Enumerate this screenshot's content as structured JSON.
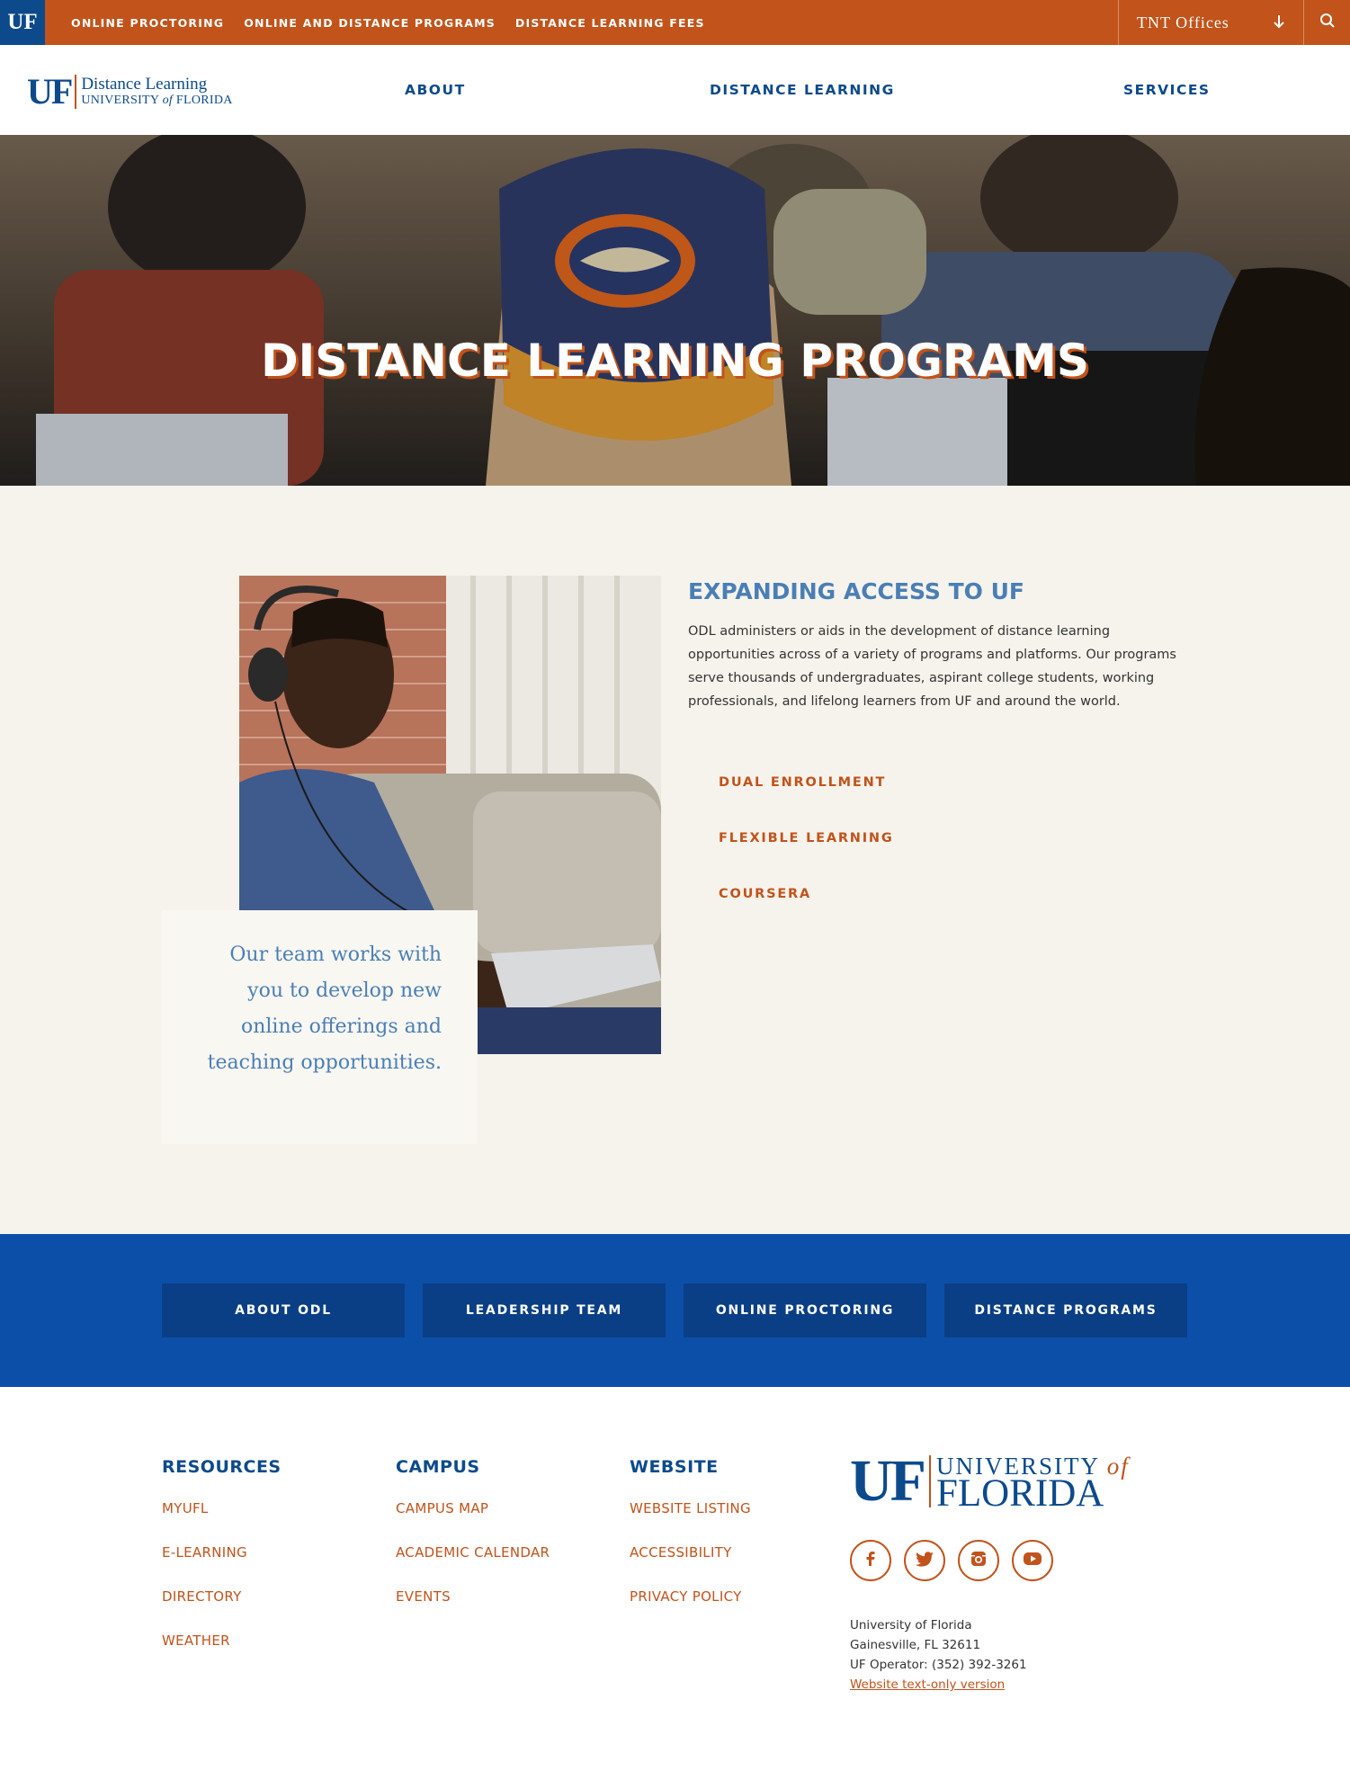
{
  "topbar": {
    "logo": "UF",
    "links": [
      "ONLINE PROCTORING",
      "ONLINE AND DISTANCE PROGRAMS",
      "DISTANCE LEARNING FEES"
    ],
    "dropdown_label": "TNT Offices"
  },
  "header": {
    "logo_uf": "UF",
    "logo_line1": "Distance Learning",
    "logo_line2_a": "UNIVERSITY ",
    "logo_line2_of": "of",
    "logo_line2_b": " FLORIDA",
    "nav": [
      "ABOUT",
      "DISTANCE LEARNING",
      "SERVICES"
    ]
  },
  "hero": {
    "title": "DISTANCE LEARNING PROGRAMS"
  },
  "content": {
    "quote": "Our team works with you to develop new online offerings and teaching opportunities.",
    "title": "EXPANDING ACCESS TO UF",
    "body": "ODL administers or aids in the development of distance learning opportunities across of a variety of programs and platforms. Our programs serve thousands of undergraduates, aspirant college students, working professionals, and lifelong learners from UF and around the world.",
    "links": [
      "DUAL ENROLLMENT",
      "FLEXIBLE LEARNING",
      "COURSERA"
    ]
  },
  "band": {
    "buttons": [
      "ABOUT ODL",
      "LEADERSHIP TEAM",
      "ONLINE PROCTORING",
      "DISTANCE PROGRAMS"
    ]
  },
  "footer": {
    "columns": [
      {
        "title": "RESOURCES",
        "links": [
          "MYUFL",
          "E-LEARNING",
          "DIRECTORY",
          "WEATHER"
        ]
      },
      {
        "title": "CAMPUS",
        "links": [
          "CAMPUS MAP",
          "ACADEMIC CALENDAR",
          "EVENTS"
        ]
      },
      {
        "title": "WEBSITE",
        "links": [
          "WEBSITE LISTING",
          "ACCESSIBILITY",
          "PRIVACY POLICY"
        ]
      }
    ],
    "logo_uf": "UF",
    "logo_university": "UNIVERSITY ",
    "logo_of": "of",
    "logo_florida": "FLORIDA",
    "social": [
      "facebook-icon",
      "twitter-icon",
      "instagram-icon",
      "youtube-icon"
    ],
    "address": [
      "University of Florida",
      "Gainesville, FL 32611",
      "UF Operator: (352) 392-3261"
    ],
    "text_only_link": "Website text-only version"
  },
  "colors": {
    "orange": "#c1531b",
    "blue": "#0c4a8c",
    "light_blue": "#4a7fb5",
    "cream": "#f6f3ec"
  }
}
